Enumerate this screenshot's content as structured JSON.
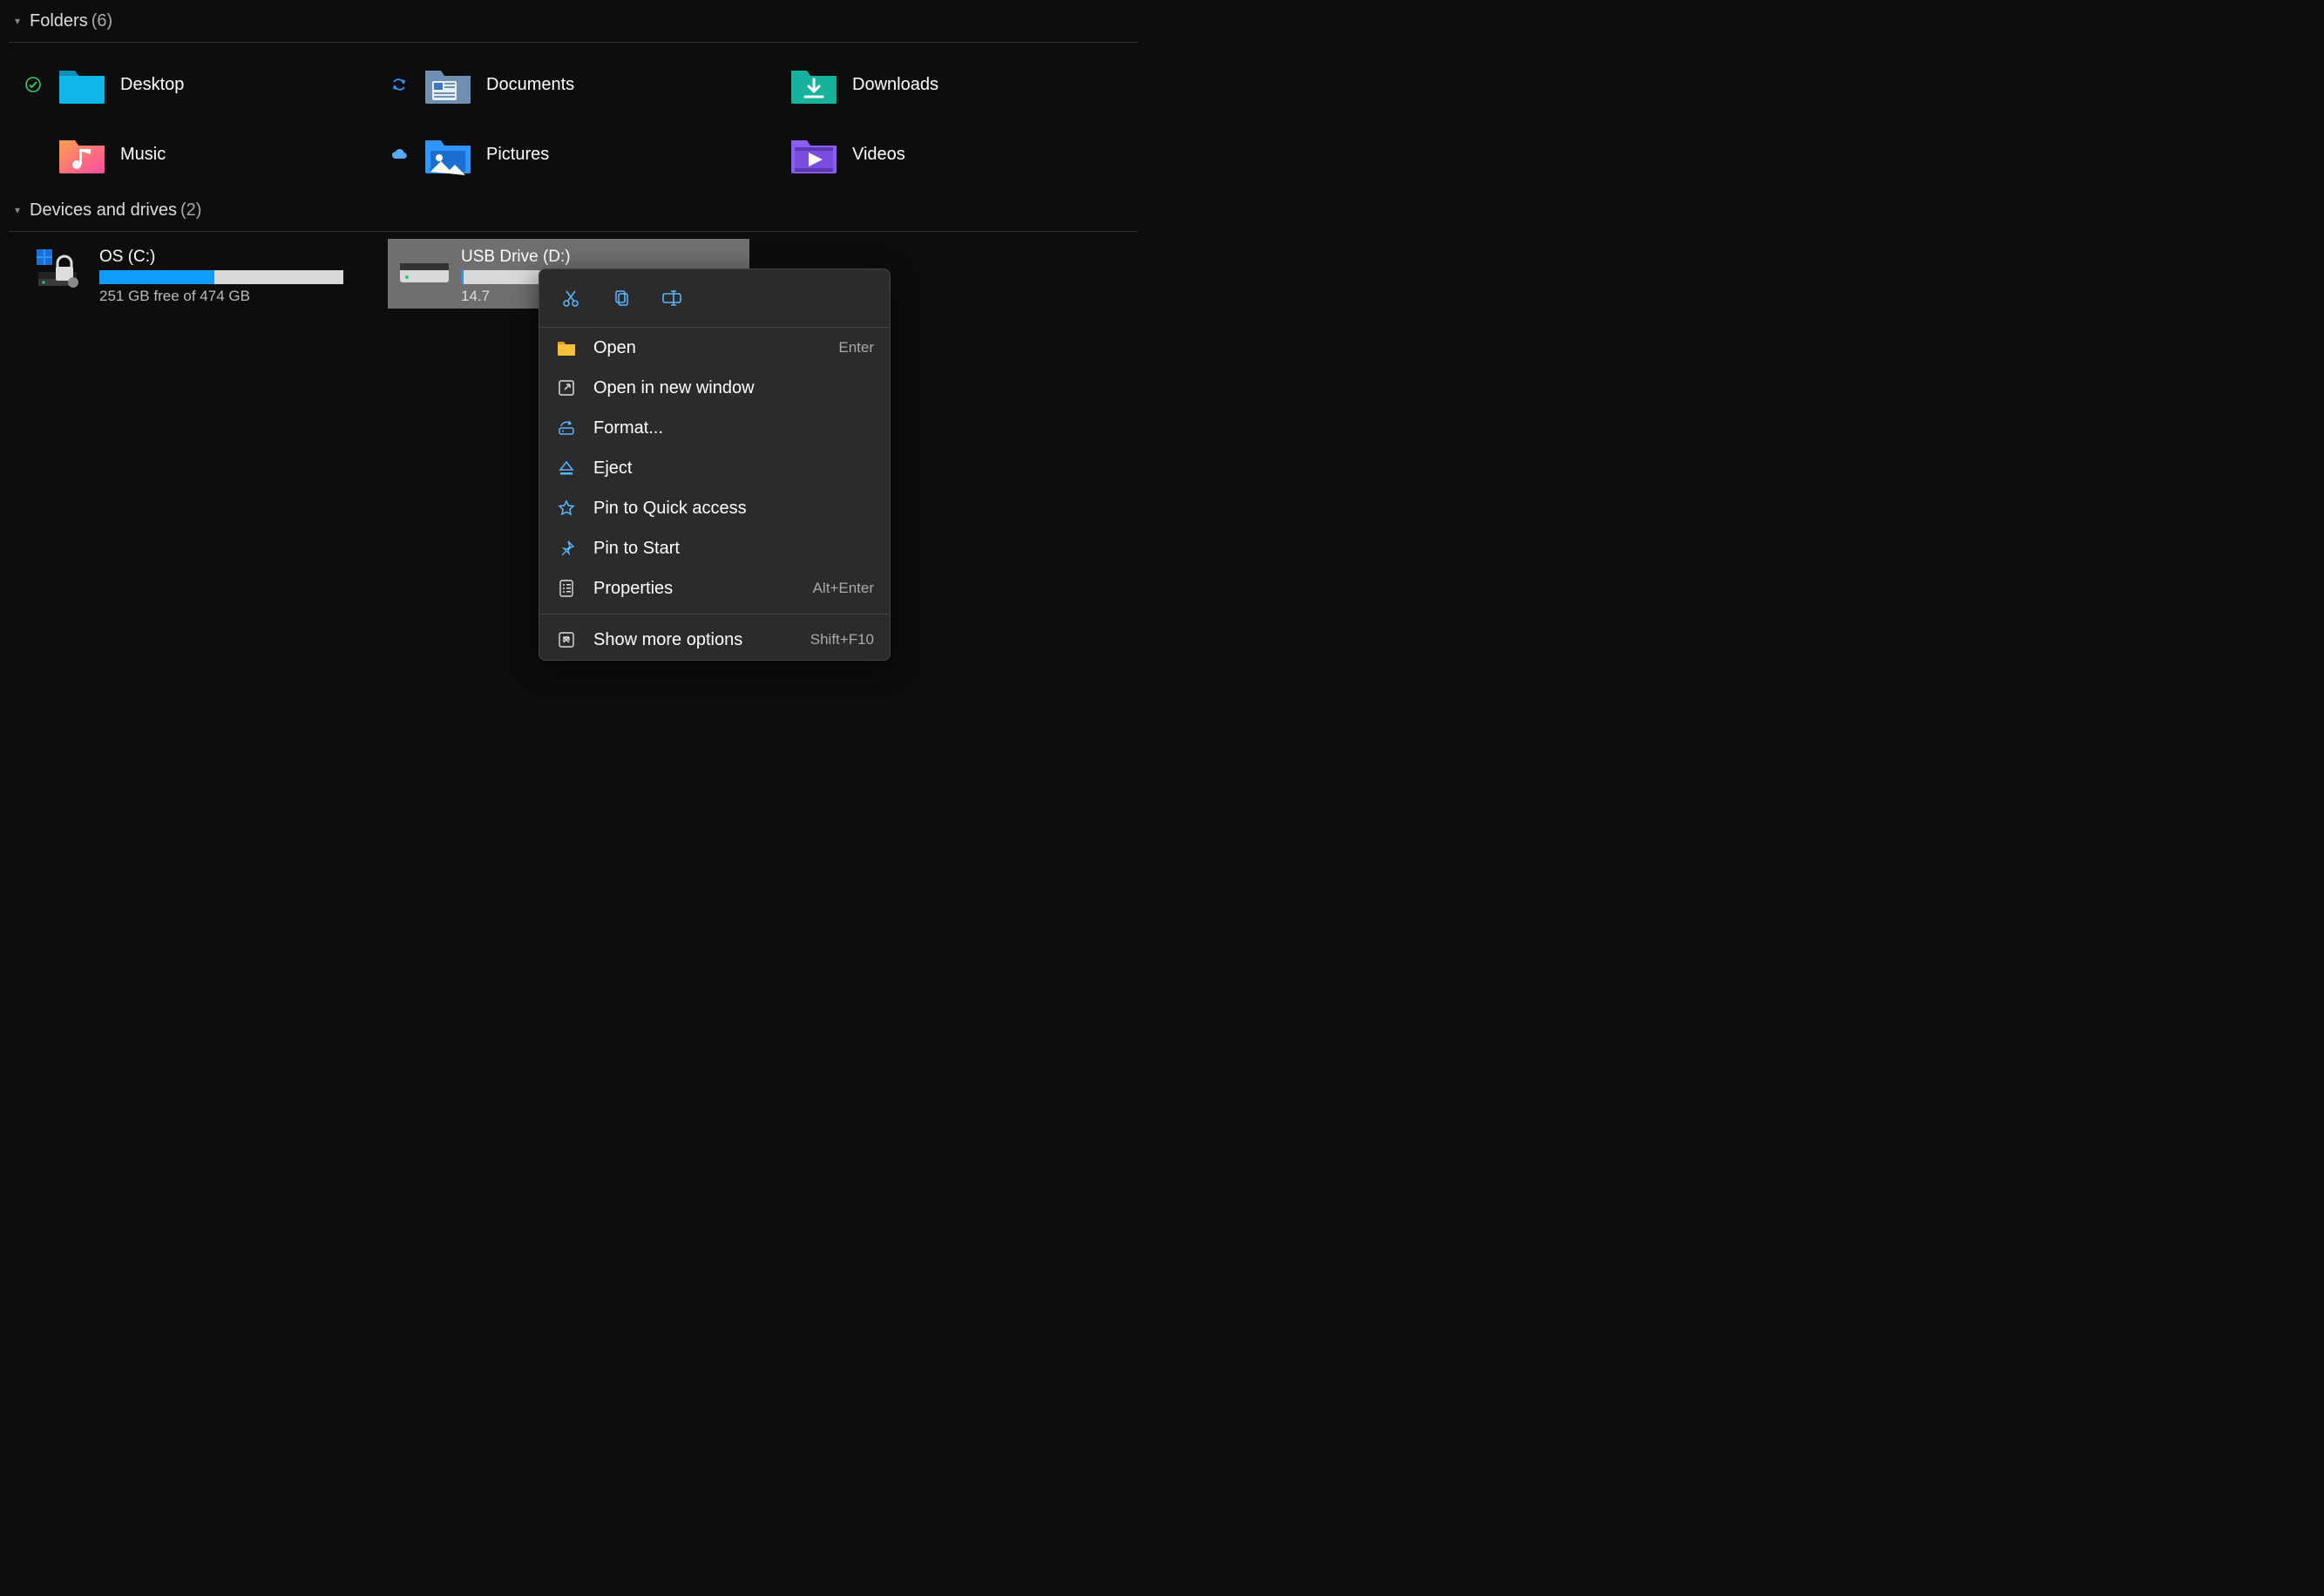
{
  "sections": {
    "folders": {
      "title": "Folders",
      "count": "(6)"
    },
    "drives": {
      "title": "Devices and drives",
      "count": "(2)"
    }
  },
  "folders": [
    {
      "label": "Desktop",
      "status": "synced"
    },
    {
      "label": "Documents",
      "status": "sync"
    },
    {
      "label": "Downloads",
      "status": ""
    },
    {
      "label": "Music",
      "status": ""
    },
    {
      "label": "Pictures",
      "status": "cloud"
    },
    {
      "label": "Videos",
      "status": ""
    }
  ],
  "drives": [
    {
      "name": "OS (C:)",
      "sub": "251 GB free of 474 GB",
      "fill_pct": 47,
      "selected": false
    },
    {
      "name": "USB Drive (D:)",
      "sub": "14.7",
      "fill_pct": 1,
      "selected": true
    }
  ],
  "context_menu": {
    "top_actions": [
      "cut",
      "copy",
      "rename"
    ],
    "items": [
      {
        "icon": "open-folder-icon",
        "label": "Open",
        "accel": "Enter"
      },
      {
        "icon": "new-window-icon",
        "label": "Open in new window",
        "accel": ""
      },
      {
        "icon": "format-icon",
        "label": "Format...",
        "accel": ""
      },
      {
        "icon": "eject-icon",
        "label": "Eject",
        "accel": ""
      },
      {
        "icon": "star-icon",
        "label": "Pin to Quick access",
        "accel": ""
      },
      {
        "icon": "pin-icon",
        "label": "Pin to Start",
        "accel": ""
      },
      {
        "icon": "properties-icon",
        "label": "Properties",
        "accel": "Alt+Enter"
      }
    ],
    "footer": {
      "icon": "more-icon",
      "label": "Show more options",
      "accel": "Shift+F10"
    }
  }
}
